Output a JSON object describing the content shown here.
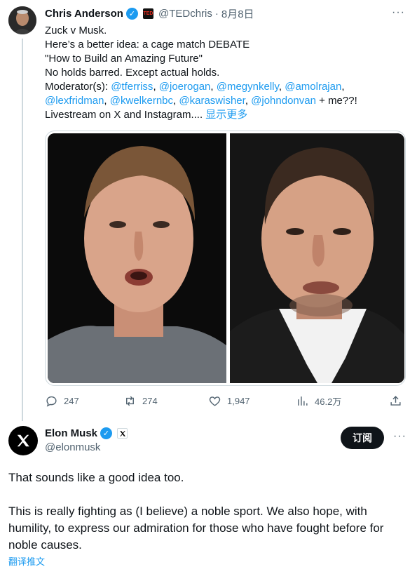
{
  "tweet1": {
    "author_name": "Chris Anderson",
    "handle": "@TEDchris",
    "separator": "·",
    "date": "8月8日",
    "lines": [
      "Zuck v Musk.",
      "Here’s a better idea: a cage match DEBATE",
      "\"How to Build an Amazing Future\"",
      "No holds barred. Except actual holds."
    ],
    "moderators_label": "Moderator(s):",
    "moderators_line1": [
      "@tferriss",
      "@joerogan",
      "@megynkelly",
      "@amolrajan"
    ],
    "moderators_line2": [
      "@lexfridman",
      "@kwelkernbc",
      "@karaswisher",
      "@johndonvan"
    ],
    "moderators_suffix": " + me??!",
    "last_line": "Livestream on X and Instagram....",
    "show_more": "显示更多",
    "replies": "247",
    "retweets": "274",
    "likes": "1,947",
    "views": "46.2万"
  },
  "tweet2": {
    "author_name": "Elon Musk",
    "handle": "@elonmusk",
    "subscribe_label": "订阅",
    "paragraph1": "That sounds like a good idea too.",
    "paragraph2": "This is really fighting as (I believe) a noble sport. We also hope, with humility, to express our admiration for those who have fought before for noble causes.",
    "translate_label": "翻译推文"
  },
  "icons": {
    "more": "more-horizontal-icon",
    "verified": "verified-badge-icon",
    "reply": "reply-icon",
    "retweet": "retweet-icon",
    "like": "heart-icon",
    "views": "views-chart-icon",
    "share": "share-icon"
  },
  "colors": {
    "accent": "#1d9bf0",
    "text": "#0f1419",
    "muted": "#536471"
  }
}
